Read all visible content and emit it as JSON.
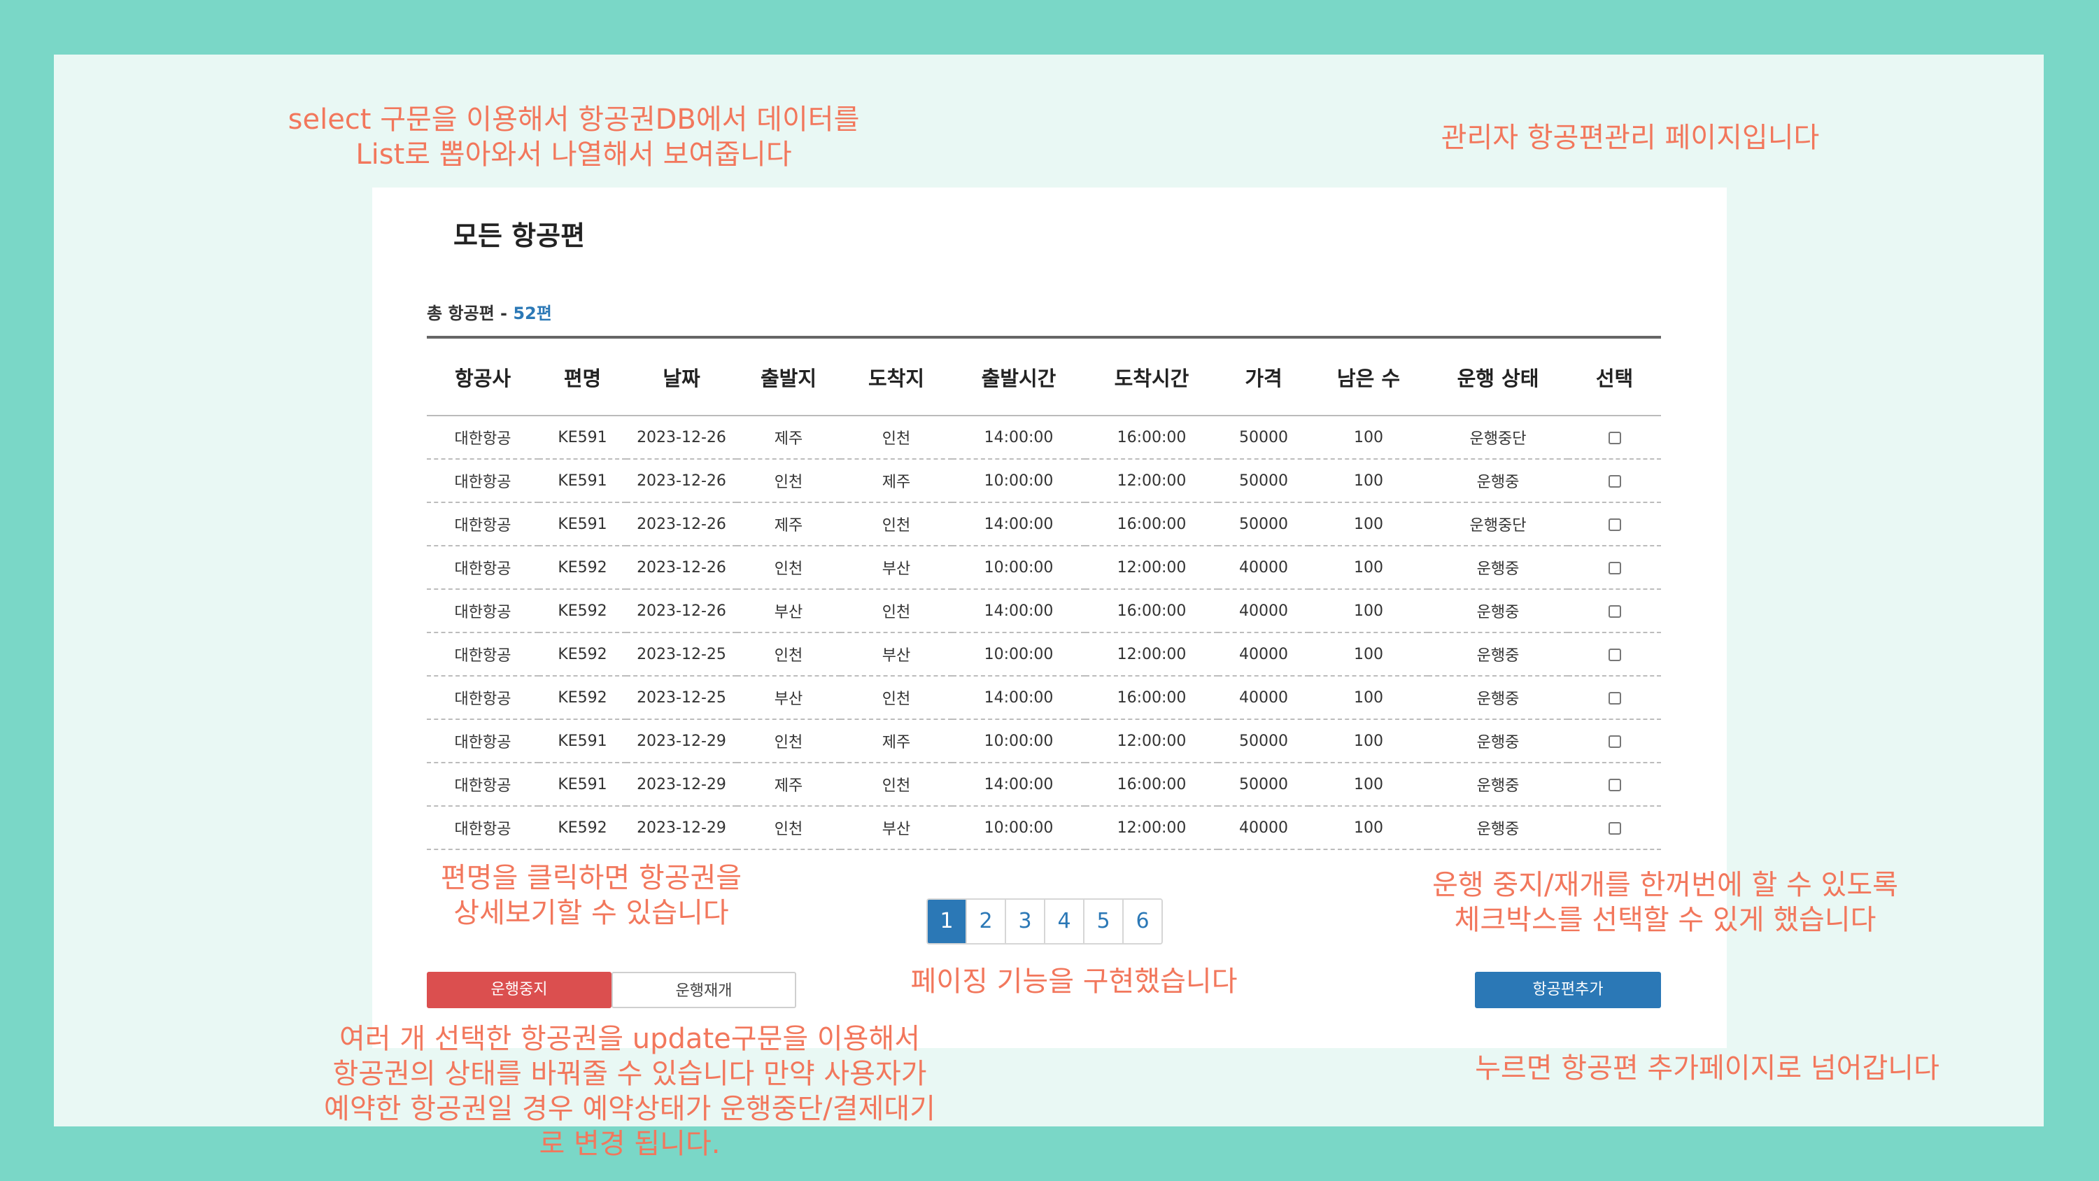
{
  "annotations": {
    "select_note": "select 구문을 이용해서 항공권DB에서 데이터를\nList로 뽑아와서 나열해서 보여줍니다",
    "admin_note": "관리자 항공편관리 페이지입니다",
    "flight_click_note": "편명을 클릭하면 항공권을\n상세보기할 수 있습니다",
    "checkbox_note": "운행 중지/재개를 한꺼번에 할 수 있도록\n체크박스를 선택할 수 있게 했습니다",
    "paging_note": "페이징 기능을 구현했습니다",
    "update_note": "여러 개 선택한 항공권을 update구문을 이용해서\n항공권의 상태를 바꿔줄 수 있습니다 만약 사용자가\n예약한 항공권일 경우 예약상태가 운행중단/결제대기\n로 변경 됩니다.",
    "add_note": "누르면 항공편 추가페이지로 넘어갑니다"
  },
  "page": {
    "title": "모든 항공편",
    "total_label": "총 항공편 - ",
    "total_count": "52편"
  },
  "table": {
    "headers": [
      "항공사",
      "편명",
      "날짜",
      "출발지",
      "도착지",
      "출발시간",
      "도착시간",
      "가격",
      "남은 수",
      "운행 상태",
      "선택"
    ],
    "rows": [
      [
        "대한항공",
        "KE591",
        "2023-12-26",
        "제주",
        "인천",
        "14:00:00",
        "16:00:00",
        "50000",
        "100",
        "운행중단"
      ],
      [
        "대한항공",
        "KE591",
        "2023-12-26",
        "인천",
        "제주",
        "10:00:00",
        "12:00:00",
        "50000",
        "100",
        "운행중"
      ],
      [
        "대한항공",
        "KE591",
        "2023-12-26",
        "제주",
        "인천",
        "14:00:00",
        "16:00:00",
        "50000",
        "100",
        "운행중단"
      ],
      [
        "대한항공",
        "KE592",
        "2023-12-26",
        "인천",
        "부산",
        "10:00:00",
        "12:00:00",
        "40000",
        "100",
        "운행중"
      ],
      [
        "대한항공",
        "KE592",
        "2023-12-26",
        "부산",
        "인천",
        "14:00:00",
        "16:00:00",
        "40000",
        "100",
        "운행중"
      ],
      [
        "대한항공",
        "KE592",
        "2023-12-25",
        "인천",
        "부산",
        "10:00:00",
        "12:00:00",
        "40000",
        "100",
        "운행중"
      ],
      [
        "대한항공",
        "KE592",
        "2023-12-25",
        "부산",
        "인천",
        "14:00:00",
        "16:00:00",
        "40000",
        "100",
        "운행중"
      ],
      [
        "대한항공",
        "KE591",
        "2023-12-29",
        "인천",
        "제주",
        "10:00:00",
        "12:00:00",
        "50000",
        "100",
        "운행중"
      ],
      [
        "대한항공",
        "KE591",
        "2023-12-29",
        "제주",
        "인천",
        "14:00:00",
        "16:00:00",
        "50000",
        "100",
        "운행중"
      ],
      [
        "대한항공",
        "KE592",
        "2023-12-29",
        "인천",
        "부산",
        "10:00:00",
        "12:00:00",
        "40000",
        "100",
        "운행중"
      ]
    ]
  },
  "pagination": {
    "pages": [
      "1",
      "2",
      "3",
      "4",
      "5",
      "6"
    ],
    "active": "1"
  },
  "buttons": {
    "stop": "운행중지",
    "resume": "운행재개",
    "add": "항공편추가"
  },
  "colors": {
    "accent_blue": "#2b78b6",
    "stop_red": "#db4f4f",
    "note_orange": "#f2775c",
    "frame_teal": "#7ad7c7"
  }
}
